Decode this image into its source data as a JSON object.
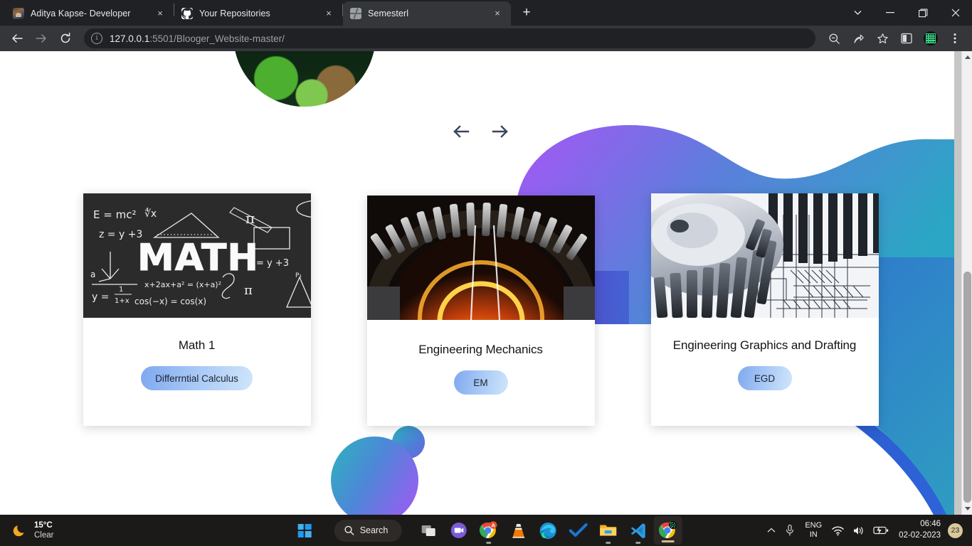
{
  "browser": {
    "tabs": [
      {
        "title": "Aditya Kapse- Developer",
        "favicon": "profile-photo-icon",
        "active": false
      },
      {
        "title": "Your Repositories",
        "favicon": "github-icon",
        "active": false
      },
      {
        "title": "Semesterl",
        "favicon": "globe-icon",
        "active": true
      }
    ],
    "new_tab_label": "+",
    "close_label": "×",
    "window_controls": [
      "tab-search-chevron",
      "minimize",
      "restore",
      "close"
    ],
    "nav": {
      "back": "←",
      "forward": "→",
      "reload": "↻"
    },
    "omnibox": {
      "host": "127.0.0.1",
      "path": ":5501/Blooger_Website-master/",
      "full_url": "127.0.0.1:5501/Blooger_Website-master/",
      "info_glyph": "i"
    },
    "toolbar_right": [
      "zoom-search-icon",
      "share-icon",
      "bookmark-star-icon",
      "side-panel-icon",
      "extension-avatar-icon",
      "chrome-menu-icon"
    ]
  },
  "page": {
    "carousel": {
      "prev_label": "previous",
      "next_label": "next"
    },
    "cards": [
      {
        "title": "Math 1",
        "button": "Differrntial Calculus",
        "image": "math-blackboard-image"
      },
      {
        "title": "Engineering Mechanics",
        "button": "EM",
        "image": "glowing-gear-image"
      },
      {
        "title": "Engineering Graphics and Drafting",
        "button": "EGD",
        "image": "gear-blueprint-image"
      }
    ],
    "decor": {
      "wave_gradient": [
        "#a855f7",
        "#4f7fd9",
        "#2ba6c4"
      ],
      "blue_wave": [
        "#2f6fd0",
        "#2f9ec0"
      ],
      "circle_gradient": [
        "#2bb5bd",
        "#4e86d8",
        "#a855f7"
      ]
    }
  },
  "taskbar": {
    "weather": {
      "temp": "15°C",
      "condition": "Clear",
      "icon": "crescent-moon-icon"
    },
    "search_label": "Search",
    "apps": [
      "task-view-icon",
      "teams-icon",
      "chrome-with-badge-icon",
      "vlc-icon",
      "edge-icon",
      "todoist-check-icon",
      "file-explorer-icon",
      "vscode-icon",
      "chrome-active-icon"
    ],
    "tray": {
      "overflow": "chevron-up-icon",
      "mic": "microphone-icon",
      "lang_line1": "ENG",
      "lang_line2": "IN",
      "wifi": "wifi-icon",
      "volume": "speaker-icon",
      "battery": "battery-charging-icon",
      "time": "06:46",
      "date": "02-02-2023",
      "notification_count": "23"
    }
  }
}
